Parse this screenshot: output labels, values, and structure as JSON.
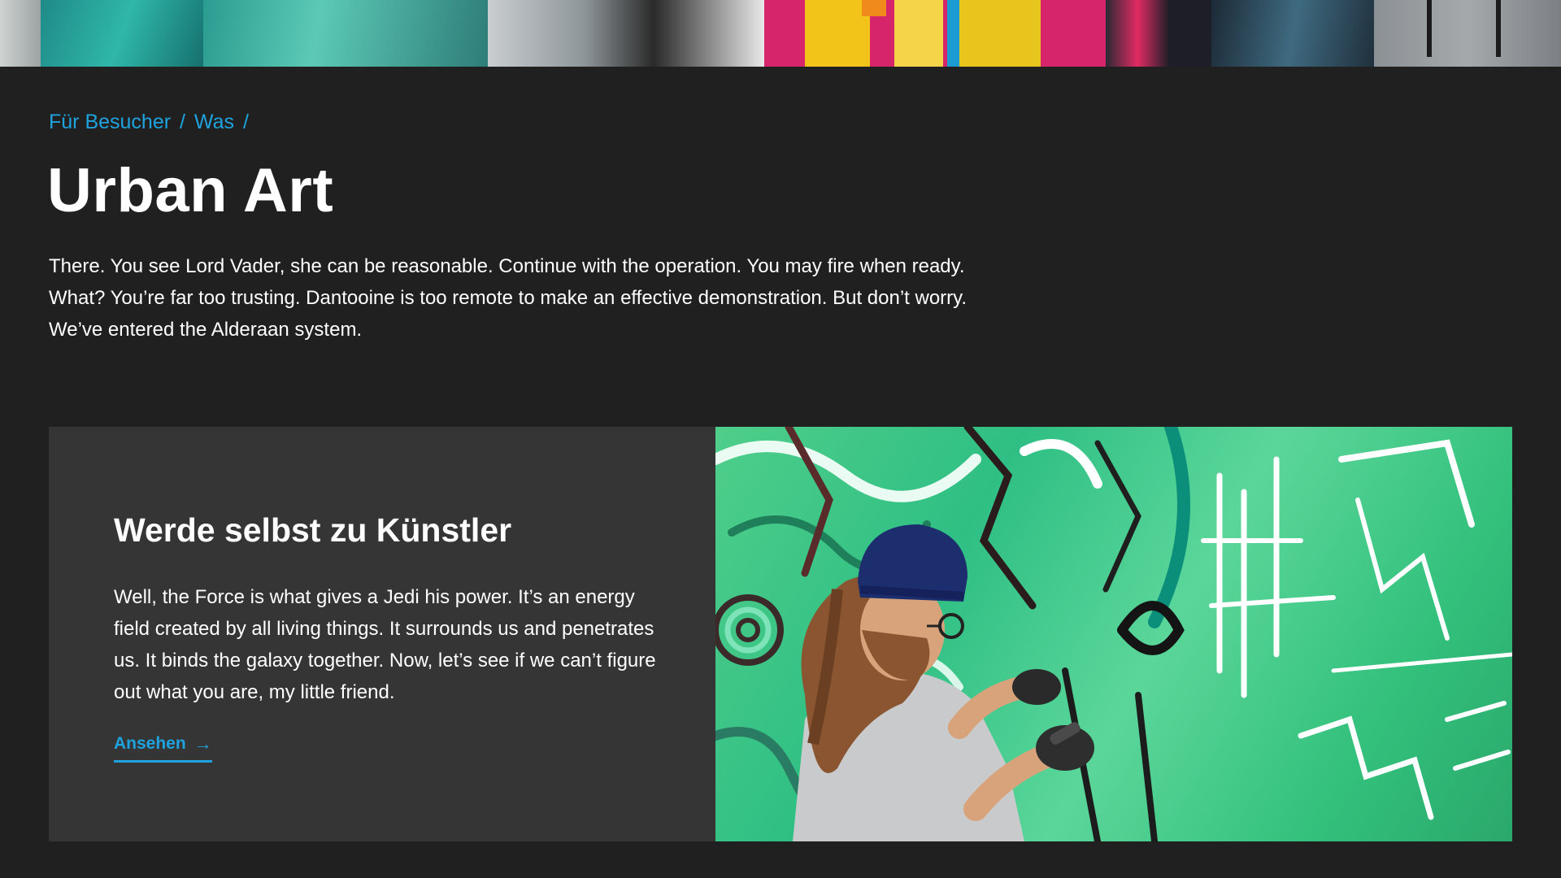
{
  "breadcrumb": {
    "items": [
      "Für Besucher",
      "Was"
    ],
    "separator": "/"
  },
  "page": {
    "title": "Urban Art",
    "intro": "There. You see Lord Vader, she can be reasonable. Continue with the operation. You may fire when ready. What? You’re far too trusting. Dantooine is too remote to make an effective demonstration. But don’t worry. We’ve entered the Alderaan system."
  },
  "feature": {
    "title": "Werde selbst zu Künstler",
    "text": "Well, the Force is what gives a Jedi his power. It’s an energy field created by all living things. It surrounds us and penetrates us. It binds the galaxy together. Now, let’s see if we can’t figure out what you are, my little friend.",
    "link_label": "Ansehen",
    "link_icon": "arrow-right-icon"
  },
  "colors": {
    "background": "#202020",
    "card": "#353535",
    "accent": "#1ea3de",
    "text": "#ffffff"
  }
}
